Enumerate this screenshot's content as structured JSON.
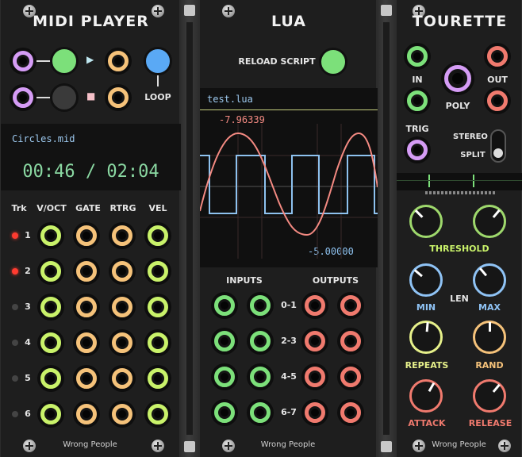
{
  "midi": {
    "title": "MIDI PLAYER",
    "loop_label": "LOOP",
    "play_symbol": "▶",
    "stop_symbol": "■",
    "file_name": "Circles.mid",
    "time": "00:46 / 02:04",
    "col_headers": [
      "Trk",
      "V/OCT",
      "GATE",
      "RTRG",
      "VEL"
    ],
    "tracks": [
      "1",
      "2",
      "3",
      "4",
      "5",
      "6"
    ],
    "track_leds_active": [
      true,
      true,
      false,
      false,
      false,
      false
    ],
    "footer": "Wrong People"
  },
  "lua": {
    "title": "LUA",
    "reload_label": "RELOAD SCRIPT",
    "script_name": "test.lua",
    "max_value": "-7.96339",
    "min_value": "-5.00000",
    "inputs_label": "INPUTS",
    "outputs_label": "OUTPUTS",
    "channel_labels": [
      "0-1",
      "2-3",
      "4-5",
      "6-7"
    ],
    "footer": "Wrong People"
  },
  "tourette": {
    "title": "TOURETTE",
    "in_label": "IN",
    "out_label": "OUT",
    "poly_label": "POLY",
    "trig_label": "TRIG",
    "stereo_label": "STEREO",
    "split_label": "SPLIT",
    "threshold_label": "THRESHOLD",
    "min_label": "MIN",
    "len_label": "LEN",
    "max_label": "MAX",
    "repeats_label": "REPEATS",
    "rand_label": "RAND",
    "attack_label": "ATTACK",
    "release_label": "RELEASE",
    "footer": "Wrong People"
  },
  "colors": {
    "green": "#c9f26a",
    "orange": "#f5c27a",
    "purple": "#d59cf5",
    "blue": "#8fc3f5",
    "red": "#f07a6e",
    "jack_green": "#7ce07a",
    "sine": "#f48a82",
    "square": "#8ec2ef",
    "display_text": "#8ad8a2"
  }
}
